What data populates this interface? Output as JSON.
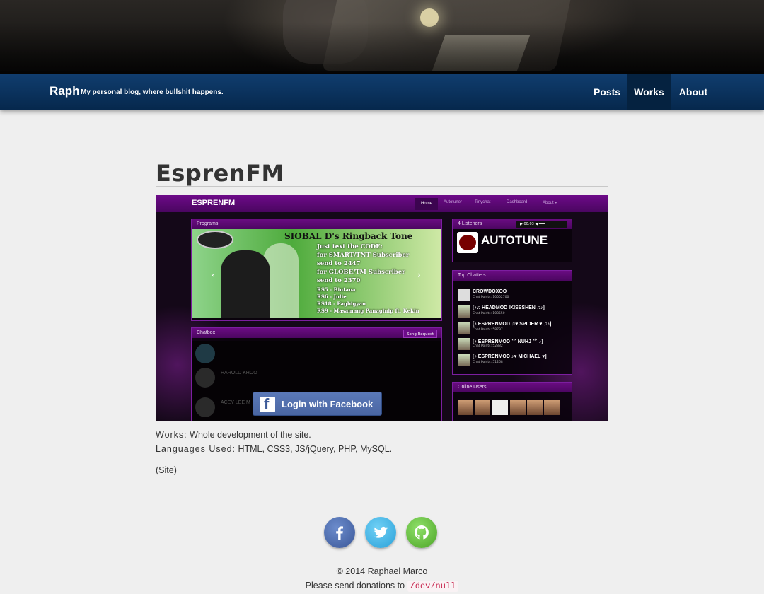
{
  "header": {
    "brand": "Raph",
    "tagline": "My personal blog, where bullshit happens."
  },
  "nav": {
    "items": [
      {
        "label": "Posts",
        "active": false
      },
      {
        "label": "Works",
        "active": true
      },
      {
        "label": "About",
        "active": false
      }
    ]
  },
  "page": {
    "title": "EsprenFM"
  },
  "screenshot": {
    "logo": "ESPRENFM",
    "nav_links": [
      "Home",
      "Autotuner",
      "Tinychat",
      "Dashboard",
      "About ▾"
    ],
    "programs_label": "Programs",
    "banner": {
      "title": "SIOBAL D's Ringback Tone",
      "lines": [
        "Just text the CODE:",
        "for SMART/TNT Subscriber",
        "send to 2447",
        "for GLOBE/TM Subscriber",
        "send to 2370",
        "RS5 - Bintana",
        "RS6 - Julie",
        "RS18 - Pagbigyan",
        "RS9 - Masamang Panaginip ft. Kekin"
      ]
    },
    "chatbox_label": "Chatbox",
    "song_request": "Song Request",
    "chat_names": [
      "HAROLD KHOO",
      "ACEY LEE M"
    ],
    "facebook_login": "Login with Facebook",
    "listeners_label": "4 Listeners",
    "player_time": "00:03",
    "now_playing": "AUTOTUNE",
    "top_chatters_label": "Top Chatters",
    "top_chatters": [
      {
        "name": "CROWDOXOO",
        "points": "Chat Points: 10002700"
      },
      {
        "name": "[♪♫ HEADMOD IKISSSHEN ♫♪]",
        "points": "Chat Points: 103550"
      },
      {
        "name": "[♪ ESPRENMOD ♫♥ SPIDER ♥ ♫♪]",
        "points": "Chat Points: 58797"
      },
      {
        "name": "[♪ ESPRENMOD ⺌ NUHJ ⺌ ♪]",
        "points": "Chat Points: 52882"
      },
      {
        "name": "[♪ ESPRENMOD ♪♥ MICHAEL ♥]",
        "points": "Chat Points: 51268"
      }
    ],
    "online_users_label": "Online Users"
  },
  "details": {
    "works_label": "Works:",
    "works_value": "Whole development of the site.",
    "languages_label": "Languages Used:",
    "languages_value": "HTML, CSS3, JS/jQuery, PHP, MySQL.",
    "site_link": "(Site)"
  },
  "footer": {
    "social": [
      "facebook-icon",
      "twitter-icon",
      "github-icon"
    ],
    "copyright": "© 2014 Raphael Marco",
    "donation_prefix": "Please send donations to",
    "donation_code": "/dev/null"
  }
}
